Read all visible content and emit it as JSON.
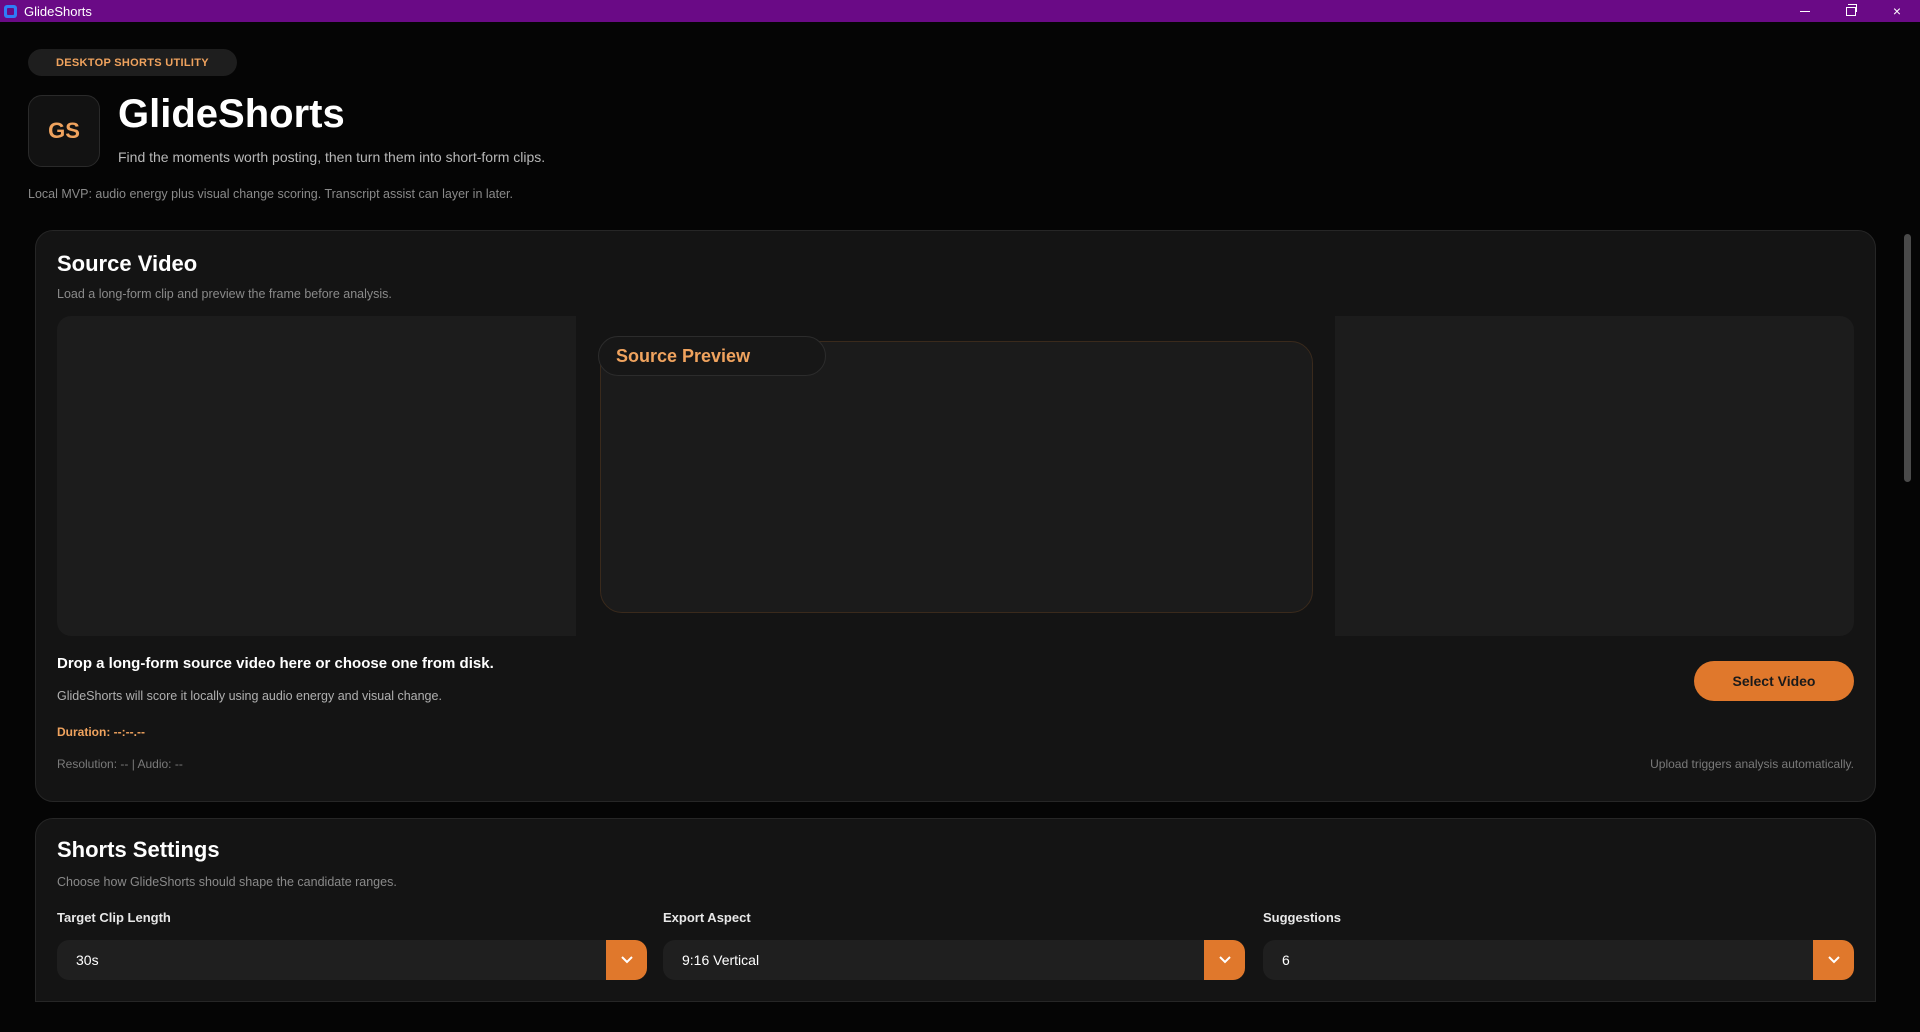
{
  "window": {
    "title": "GlideShorts",
    "controls": {
      "minimize": "minimize-icon",
      "restore": "restore-icon",
      "close": "×"
    }
  },
  "header": {
    "badge": "DESKTOP SHORTS UTILITY",
    "logo": "GS",
    "title": "GlideShorts",
    "tagline": "Find the moments worth posting, then turn them into short-form clips.",
    "note": "Local MVP: audio energy plus visual change scoring. Transcript assist can layer in later."
  },
  "source": {
    "title": "Source Video",
    "subtitle": "Load a long-form clip and preview the frame before analysis.",
    "preview_label": "Source Preview",
    "drop_title": "Drop a long-form source video here or choose one from disk.",
    "drop_subtitle": "GlideShorts will score it locally using audio energy and visual change.",
    "duration": "Duration: --:--.--",
    "meta": "Resolution: -- | Audio: --",
    "hint": "Upload triggers analysis automatically.",
    "select_button": "Select Video"
  },
  "settings": {
    "title": "Shorts Settings",
    "subtitle": "Choose how GlideShorts should shape the candidate ranges.",
    "fields": [
      {
        "label": "Target Clip Length",
        "value": "30s"
      },
      {
        "label": "Export Aspect",
        "value": "9:16 Vertical"
      },
      {
        "label": "Suggestions",
        "value": "6"
      }
    ]
  },
  "colors": {
    "titlebar": "#6a0a86",
    "accent": "#e0782c",
    "accent_text": "#f0a35e",
    "background": "#050505",
    "card": "#141414"
  }
}
